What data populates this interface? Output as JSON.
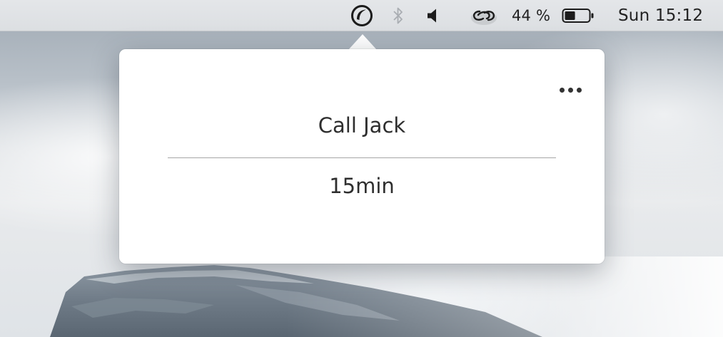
{
  "menubar": {
    "status_items": [
      {
        "icon": "timer-app-icon",
        "active": true
      },
      {
        "icon": "bluetooth-icon",
        "active": false
      },
      {
        "icon": "volume-icon",
        "active": true
      },
      {
        "icon": "linked-rings-icon",
        "active": true
      }
    ],
    "battery": {
      "percent_label": "44 %",
      "level": 0.44
    },
    "clock": "Sun 15:12"
  },
  "popover": {
    "task_title": "Call Jack",
    "task_duration": "15min",
    "more_icon": "ellipsis-icon"
  },
  "colors": {
    "menubar_bg": "#dfe1e4",
    "popover_bg": "#ffffff",
    "text": "#2e2e2e",
    "divider": "#a6a6a6",
    "bluetooth_inactive": "#a9adb2"
  }
}
